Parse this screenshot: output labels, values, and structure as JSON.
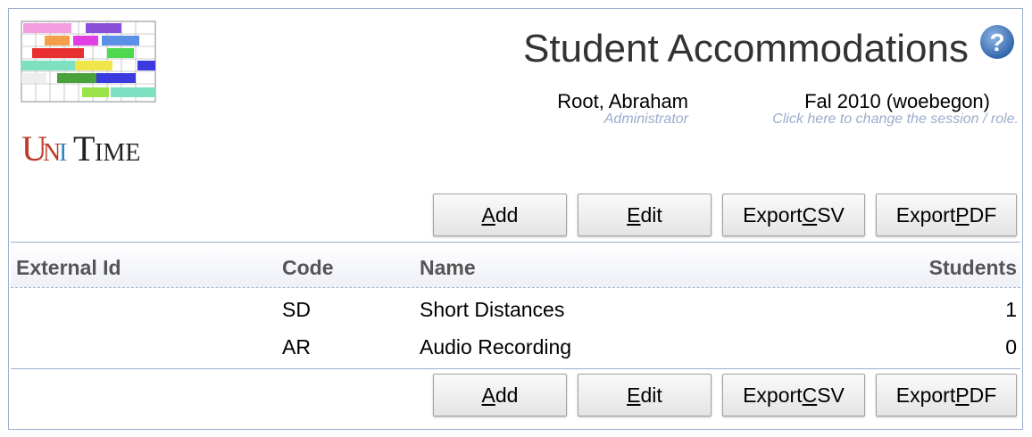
{
  "app": {
    "logo_text": "UniTime"
  },
  "header": {
    "title": "Student Accommodations",
    "user_name": "Root, Abraham",
    "user_role": "Administrator",
    "session_name": "Fal 2010 (woebegon)",
    "session_hint": "Click here to change the session / role."
  },
  "buttons": {
    "add": {
      "pre": "",
      "key": "A",
      "post": "dd"
    },
    "edit": {
      "pre": "",
      "key": "E",
      "post": "dit"
    },
    "export_csv": {
      "pre": "Export ",
      "key": "C",
      "post": "SV"
    },
    "export_pdf": {
      "pre": "Export ",
      "key": "P",
      "post": "DF"
    }
  },
  "table": {
    "columns": {
      "external_id": "External Id",
      "code": "Code",
      "name": "Name",
      "students": "Students"
    },
    "rows": [
      {
        "external_id": "",
        "code": "SD",
        "name": "Short Distances",
        "students": "1"
      },
      {
        "external_id": "",
        "code": "AR",
        "name": "Audio Recording",
        "students": "0"
      }
    ]
  },
  "colors": {
    "border": "#9cb0ce",
    "hint": "#9aaccd",
    "help_icon": "#4a7ab5"
  },
  "icons": {
    "help": "question-mark-circle-icon"
  }
}
